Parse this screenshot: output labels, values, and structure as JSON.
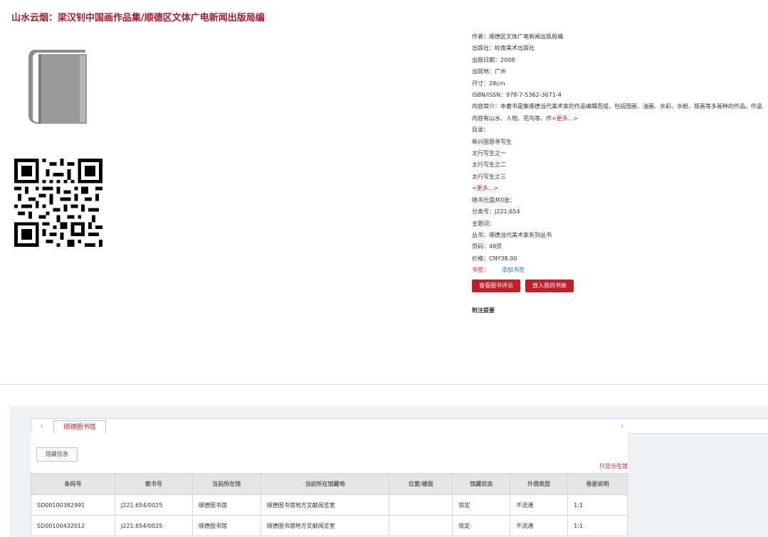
{
  "book": {
    "title": "山水云烟：梁汉钊中国画作品集/顺德区文体广电新闻出版局编"
  },
  "details": {
    "author": "作者：顺德区文体广电新闻出版局编",
    "publisher": "出版社：岭南美术出版社",
    "pub_date": "出版日期：2008",
    "pub_place": "出版地：广州",
    "size": "尺寸：28cm",
    "isbn": "ISBN/ISSN：978-7-5362-3671-4",
    "summary": "内容简介：本套书是集顺德当代美术家的作品编辑而成，包括国画、油画、水彩、水粉、版画等多画种的作品。作品内容有山水、人物、花鸟等，作",
    "summary_more": "<更多...>",
    "toc_label": "目录：",
    "toc_items": [
      "新兴国恩寺写生",
      "太行写生之一",
      "太行写生之二",
      "太行写生之三"
    ],
    "toc_more": "<更多...>",
    "attachment": "随书光盘共0张：",
    "class_no": "分类号：J221.654",
    "subject": "主题词：",
    "series": "丛书：顺德当代美术家系列丛书",
    "pages": "页码：48页",
    "price": "价格：CNY38.00",
    "bookmark_label": "书签：",
    "bookmark_link": "添加书签"
  },
  "actions": {
    "review_button": "查看图书评论",
    "shelf_button": "放入我的书架",
    "note_heading": "附注提要"
  },
  "holdings": {
    "library_tab": "顺德图书馆",
    "prev_icon": "‹",
    "next_icon": "›",
    "subtab": "馆藏信息",
    "filter_link": "只显示在馆",
    "columns": [
      "条码号",
      "索书号",
      "当前所在馆",
      "当前所在馆藏地",
      "位置/楼层",
      "馆藏状态",
      "外借类型",
      "卷册说明"
    ],
    "rows": [
      [
        "SD00100382991",
        "J221.654/0025",
        "顺德图书馆",
        "顺德图书馆地方文献阅览室",
        "",
        "锁定",
        "不流通",
        "1:1"
      ],
      [
        "SD00100432012",
        "J221.654/0025",
        "顺德图书馆",
        "顺德图书馆地方文献阅览室",
        "",
        "锁定",
        "不流通",
        "1:1"
      ]
    ]
  },
  "colors": {
    "accent": "#c0202b",
    "title": "#a51c2a",
    "link": "#2a6db8"
  }
}
